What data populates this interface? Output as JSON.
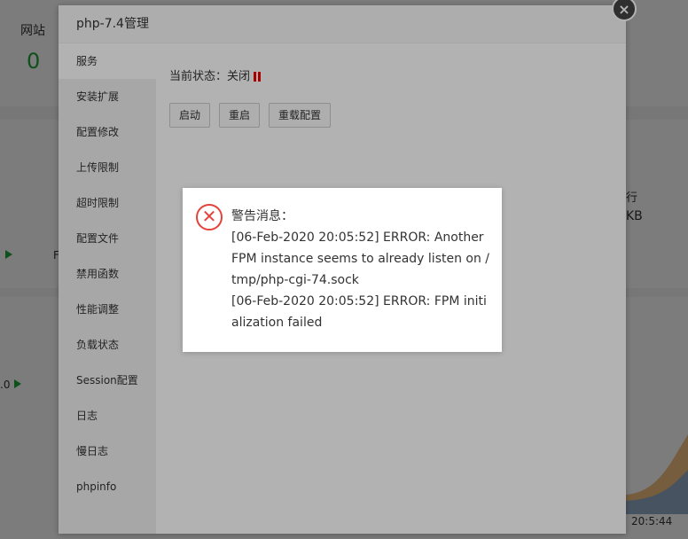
{
  "background": {
    "stat_label": "网站",
    "stat_value": "0",
    "right_label": "行",
    "right_value": "KB",
    "small_a": "F",
    "small_b": ".0",
    "time_label": "20:5:44"
  },
  "modal": {
    "title": "php-7.4管理",
    "close_label": "×",
    "sidebar": [
      {
        "label": "服务"
      },
      {
        "label": "安装扩展"
      },
      {
        "label": "配置修改"
      },
      {
        "label": "上传限制"
      },
      {
        "label": "超时限制"
      },
      {
        "label": "配置文件"
      },
      {
        "label": "禁用函数"
      },
      {
        "label": "性能调整"
      },
      {
        "label": "负载状态"
      },
      {
        "label": "Session配置"
      },
      {
        "label": "日志"
      },
      {
        "label": "慢日志"
      },
      {
        "label": "phpinfo"
      }
    ],
    "status_label": "当前状态：关闭",
    "buttons": {
      "start": "启动",
      "restart": "重启",
      "reload": "重载配置"
    }
  },
  "alert": {
    "icon": "error-icon",
    "heading": "警告消息：",
    "message": "[06-Feb-2020 20:05:52] ERROR: Another FPM instance seems to already listen on /tmp/php-cgi-74.sock",
    "message2": "[06-Feb-2020 20:05:52] ERROR: FPM initialization failed"
  },
  "colors": {
    "accent_green": "#20a53a",
    "error_red": "#e4433b",
    "status_red": "#ee0000"
  }
}
